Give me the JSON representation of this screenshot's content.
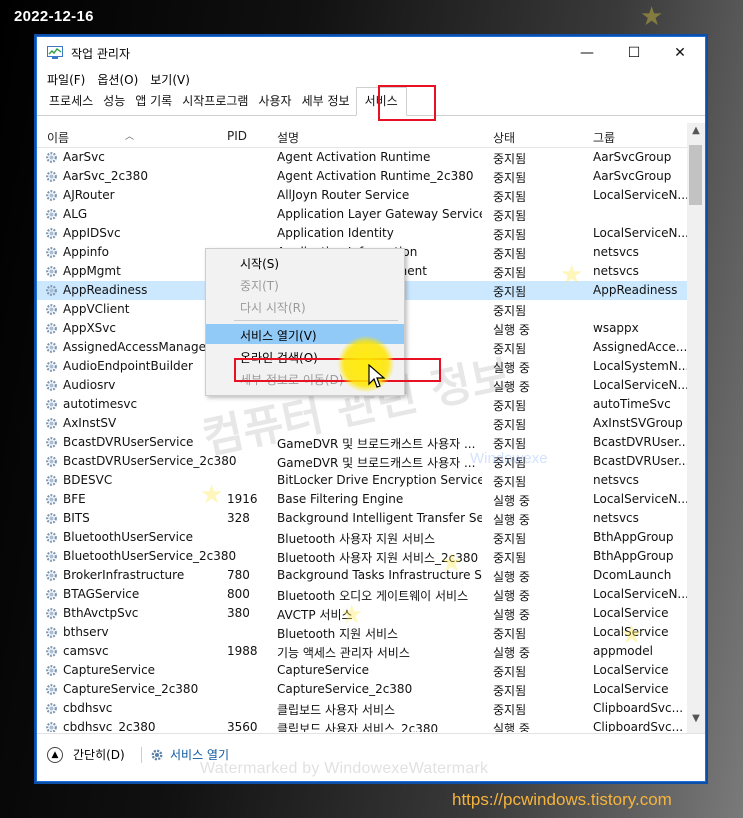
{
  "overlay": {
    "date": "2022-12-16",
    "site_url": "https://pcwindows.tistory.com",
    "watermark_text": "컴퓨터 관련 정보",
    "watermark_sub": "Windowexe",
    "watermark_bottom": "Watermarked by WindowexeWatermark"
  },
  "window": {
    "title": "작업 관리자",
    "controls": {
      "minimize": "—",
      "maximize": "☐",
      "close": "✕"
    }
  },
  "menu": [
    "파일(F)",
    "옵션(O)",
    "보기(V)"
  ],
  "tabs": [
    "프로세스",
    "성능",
    "앱 기록",
    "시작프로그램",
    "사용자",
    "세부 정보",
    "서비스"
  ],
  "active_tab": "서비스",
  "columns": {
    "name": "이름",
    "pid": "PID",
    "description": "설명",
    "status": "상태",
    "group": "그룹"
  },
  "rows": [
    {
      "name": "AarSvc",
      "pid": "",
      "description": "Agent Activation Runtime",
      "status": "중지됨",
      "group": "AarSvcGroup"
    },
    {
      "name": "AarSvc_2c380",
      "pid": "",
      "description": "Agent Activation Runtime_2c380",
      "status": "중지됨",
      "group": "AarSvcGroup"
    },
    {
      "name": "AJRouter",
      "pid": "",
      "description": "AllJoyn Router Service",
      "status": "중지됨",
      "group": "LocalServiceN..."
    },
    {
      "name": "ALG",
      "pid": "",
      "description": "Application Layer Gateway Service",
      "status": "중지됨",
      "group": ""
    },
    {
      "name": "AppIDSvc",
      "pid": "",
      "description": "Application Identity",
      "status": "중지됨",
      "group": "LocalServiceN..."
    },
    {
      "name": "Appinfo",
      "pid": "",
      "description": "Application Information",
      "status": "중지됨",
      "group": "netsvcs"
    },
    {
      "name": "AppMgmt",
      "pid": "",
      "description": "Application Management",
      "status": "중지됨",
      "group": "netsvcs"
    },
    {
      "name": "AppReadiness",
      "pid": "",
      "description": "",
      "status": "중지됨",
      "group": "AppReadiness",
      "selected": true
    },
    {
      "name": "AppVClient",
      "pid": "",
      "description": "",
      "status": "중지됨",
      "group": ""
    },
    {
      "name": "AppXSvc",
      "pid": "30",
      "description": "pXSV...",
      "status": "실행 중",
      "group": "wsappx"
    },
    {
      "name": "AssignedAccessManagerSvc",
      "pid": "",
      "description": "",
      "status": "중지됨",
      "group": "AssignedAcce..."
    },
    {
      "name": "AudioEndpointBuilder",
      "pid": "10",
      "description": "der",
      "status": "실행 중",
      "group": "LocalSystemN..."
    },
    {
      "name": "Audiosrv",
      "pid": "17",
      "description": "",
      "status": "실행 중",
      "group": "LocalServiceN..."
    },
    {
      "name": "autotimesvc",
      "pid": "",
      "description": "",
      "status": "중지됨",
      "group": "autoTimeSvc"
    },
    {
      "name": "AxInstSV",
      "pid": "",
      "description": "",
      "status": "중지됨",
      "group": "AxInstSVGroup"
    },
    {
      "name": "BcastDVRUserService",
      "pid": "",
      "description": "GameDVR 및 브로드캐스트 사용자 ...",
      "status": "중지됨",
      "group": "BcastDVRUser..."
    },
    {
      "name": "BcastDVRUserService_2c380",
      "pid": "",
      "description": "GameDVR 및 브로드캐스트 사용자 ...",
      "status": "중지됨",
      "group": "BcastDVRUser..."
    },
    {
      "name": "BDESVC",
      "pid": "",
      "description": "BitLocker Drive Encryption Service",
      "status": "중지됨",
      "group": "netsvcs"
    },
    {
      "name": "BFE",
      "pid": "1916",
      "description": "Base Filtering Engine",
      "status": "실행 중",
      "group": "LocalServiceN..."
    },
    {
      "name": "BITS",
      "pid": "328",
      "description": "Background Intelligent Transfer Ser...",
      "status": "실행 중",
      "group": "netsvcs"
    },
    {
      "name": "BluetoothUserService",
      "pid": "",
      "description": "Bluetooth 사용자 지원 서비스",
      "status": "중지됨",
      "group": "BthAppGroup"
    },
    {
      "name": "BluetoothUserService_2c380",
      "pid": "",
      "description": "Bluetooth 사용자 지원 서비스_2c380",
      "status": "중지됨",
      "group": "BthAppGroup"
    },
    {
      "name": "BrokerInfrastructure",
      "pid": "780",
      "description": "Background Tasks Infrastructure Ser...",
      "status": "실행 중",
      "group": "DcomLaunch"
    },
    {
      "name": "BTAGService",
      "pid": "800",
      "description": "Bluetooth 오디오 게이트웨이 서비스",
      "status": "실행 중",
      "group": "LocalServiceN..."
    },
    {
      "name": "BthAvctpSvc",
      "pid": "380",
      "description": "AVCTP 서비스",
      "status": "실행 중",
      "group": "LocalService"
    },
    {
      "name": "bthserv",
      "pid": "",
      "description": "Bluetooth 지원 서비스",
      "status": "중지됨",
      "group": "LocalService"
    },
    {
      "name": "camsvc",
      "pid": "1988",
      "description": "기능 액세스 관리자 서비스",
      "status": "실행 중",
      "group": "appmodel"
    },
    {
      "name": "CaptureService",
      "pid": "",
      "description": "CaptureService",
      "status": "중지됨",
      "group": "LocalService"
    },
    {
      "name": "CaptureService_2c380",
      "pid": "",
      "description": "CaptureService_2c380",
      "status": "중지됨",
      "group": "LocalService"
    },
    {
      "name": "cbdhsvc",
      "pid": "",
      "description": "클립보드 사용자 서비스",
      "status": "중지됨",
      "group": "ClipboardSvc..."
    },
    {
      "name": "cbdhsvc_2c380",
      "pid": "3560",
      "description": "클립보드 사용자 서비스_2c380",
      "status": "실행 중",
      "group": "ClipboardSvc..."
    }
  ],
  "context_menu": [
    {
      "label": "시작(S)",
      "disabled": false
    },
    {
      "label": "중지(T)",
      "disabled": true
    },
    {
      "label": "다시 시작(R)",
      "disabled": true
    },
    {
      "label": "서비스 열기(V)",
      "disabled": false,
      "hover": true
    },
    {
      "label": "온라인 검색(O)",
      "disabled": false
    },
    {
      "label": "세부 정보로 이동(D)",
      "disabled": true
    }
  ],
  "footer": {
    "fewer_details": "간단히(D)",
    "open_services": "서비스 열기"
  }
}
